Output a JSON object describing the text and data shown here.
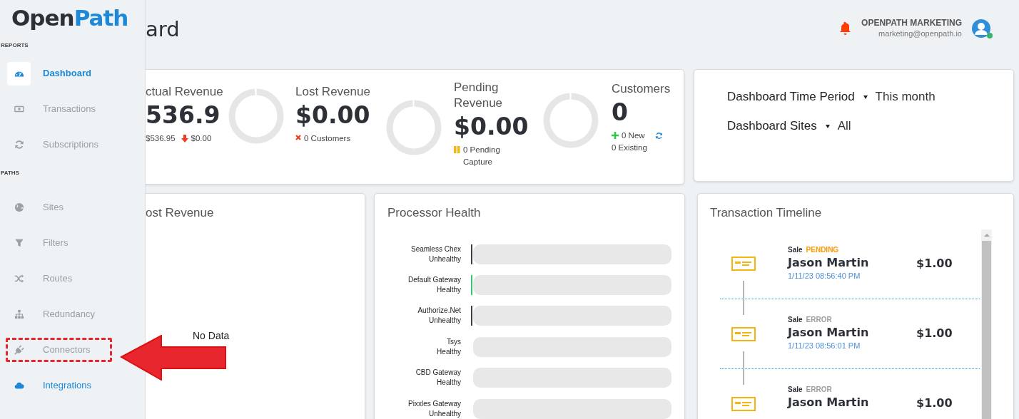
{
  "sidebar": {
    "logo": {
      "part_1": "Open",
      "part_2": "Path"
    },
    "sections": [
      {
        "label": "REPORTS",
        "items": [
          {
            "label": "Dashboard",
            "kind": "gauge",
            "selected": true,
            "highlighted": false,
            "annotated": false
          },
          {
            "label": "Transactions",
            "kind": "banknote",
            "selected": false,
            "highlighted": false,
            "annotated": false
          },
          {
            "label": "Subscriptions",
            "kind": "refresh",
            "selected": false,
            "highlighted": false,
            "annotated": false
          }
        ]
      },
      {
        "label": "PATHS",
        "items": [
          {
            "label": "Sites",
            "kind": "globe",
            "selected": false,
            "highlighted": false,
            "annotated": false
          },
          {
            "label": "Filters",
            "kind": "funnel",
            "selected": false,
            "highlighted": false,
            "annotated": false
          },
          {
            "label": "Routes",
            "kind": "shuffle",
            "selected": false,
            "highlighted": false,
            "annotated": false
          },
          {
            "label": "Redundancy",
            "kind": "hierarchy",
            "selected": false,
            "highlighted": false,
            "annotated": false
          },
          {
            "label": "Connectors",
            "kind": "plug",
            "selected": false,
            "highlighted": false,
            "annotated": true
          },
          {
            "label": "Integrations",
            "kind": "cloud",
            "selected": false,
            "highlighted": true,
            "annotated": false
          }
        ]
      }
    ]
  },
  "header": {
    "title": "ard",
    "user_name": "OPENPATH MARKETING",
    "user_email": "marketing@openpath.io",
    "online": true
  },
  "summary": {
    "metrics": [
      {
        "title": "ctual Revenue",
        "value": "536.9",
        "donut": true,
        "details": [
          [
            {
              "kind": "text",
              "text": "$536.95"
            },
            {
              "kind": "down",
              "text": "$0.00"
            }
          ]
        ]
      },
      {
        "title": "Lost Revenue",
        "value": "$0.00",
        "donut": true,
        "details": [
          [
            {
              "kind": "cross",
              "text": "0 Customers"
            }
          ]
        ]
      },
      {
        "title": "Pending Revenue",
        "value": "$0.00",
        "donut": true,
        "details": [
          [
            {
              "kind": "pause",
              "text": "0 Pending Capture"
            }
          ]
        ]
      },
      {
        "title": "Customers",
        "value": "0",
        "donut": false,
        "details": [
          [
            {
              "kind": "plus",
              "text": "0 New"
            },
            {
              "kind": "refresh"
            }
          ],
          [
            {
              "kind": "text",
              "text": "0 Existing"
            }
          ]
        ]
      }
    ]
  },
  "filters": [
    {
      "label": "Dashboard Time Period",
      "value": "This month"
    },
    {
      "label": "Dashboard Sites",
      "value": "All"
    }
  ],
  "lost_revenue": {
    "title": "ost Revenue",
    "empty_text": "No Data"
  },
  "processor_health": {
    "title": "Processor Health",
    "processors": [
      {
        "name": "Seamless Chex",
        "status": "Unhealthy",
        "color": "#3a3f47"
      },
      {
        "name": "Default Gateway",
        "status": "Healthy",
        "color": "#2ecc71"
      },
      {
        "name": "Authorize.Net",
        "status": "Unhealthy",
        "color": "#3a3f47"
      },
      {
        "name": "Tsys",
        "status": "Healthy"
      },
      {
        "name": "CBD Gateway",
        "status": "Healthy"
      },
      {
        "name": "Pixxles Gateway",
        "status": "Unhealthy"
      }
    ]
  },
  "timeline": {
    "title": "Transaction Timeline",
    "items": [
      {
        "type": "Sale",
        "status": "PENDING",
        "kind": "pending",
        "name": "Jason Martin",
        "amount": "$1.00",
        "time": "1/11/23 08:56:40 PM"
      },
      {
        "type": "Sale",
        "status": "ERROR",
        "kind": "error",
        "name": "Jason Martin",
        "amount": "$1.00",
        "time": "1/11/23 08:56:01 PM"
      },
      {
        "type": "Sale",
        "status": "ERROR",
        "kind": "error",
        "name": "Jason Martin",
        "amount": "$1.00"
      }
    ]
  }
}
